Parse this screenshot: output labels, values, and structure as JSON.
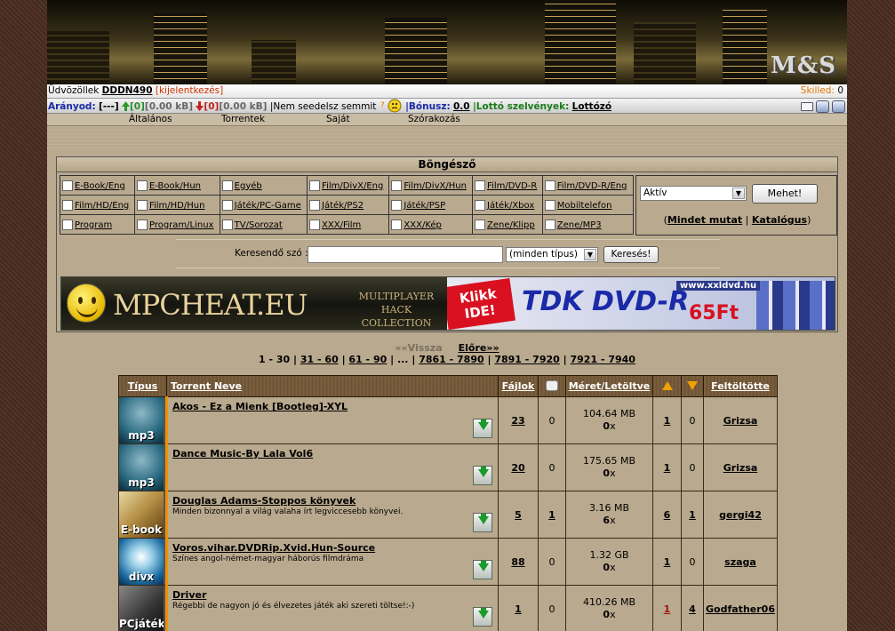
{
  "header": {
    "logo": "M&S"
  },
  "userbar": {
    "greeting": "Üdvözöllek",
    "username": "DDDN490",
    "logout": "[kijelentkezés]",
    "skilled_label": "Skilled:",
    "skilled_value": "0"
  },
  "statbar": {
    "ratio_label": "Arányod:",
    "ratio_value": "[---]",
    "up_count": "[0]",
    "up_size": "[0.00 kB]",
    "down_count": "[0]",
    "down_size": "[0.00 kB]",
    "seed_status": "|Nem seedelsz semmit",
    "bonus_label": "|Bónusz:",
    "bonus_value": "0.0",
    "lotto_label": "|Lottó szelvények:",
    "lotto_link": "Lottózó"
  },
  "menu": [
    "Általános",
    "Torrentek",
    "Saját",
    "Szórakozás"
  ],
  "browser": {
    "title": "Böngésző",
    "categories": [
      [
        "E-Book/Eng",
        "E-Book/Hun",
        "Egyéb",
        "Film/DivX/Eng",
        "Film/DivX/Hun",
        "Film/DVD-R",
        "Film/DVD-R/Eng"
      ],
      [
        "Film/HD/Eng",
        "Film/HD/Hun",
        "Játék/PC-Game",
        "Játék/PS2",
        "Játék/PSP",
        "Játék/Xbox",
        "Mobiltelefon"
      ],
      [
        "Program",
        "Program/Linux",
        "TV/Sorozat",
        "XXX/Film",
        "XXX/Kép",
        "Zene/Klipp",
        "Zene/MP3"
      ]
    ],
    "status_select": "Aktív",
    "go_button": "Mehet!",
    "link_open": "(",
    "show_all": "Mindet mutat",
    "sep": "|",
    "catalog": "Katalógus",
    "link_close": ")",
    "search_label": "Keresendő szó :",
    "search_value": "",
    "type_select": "(minden típus)",
    "search_button": "Keresés!"
  },
  "ads": {
    "ad1_title": "MPCHEAT.EU",
    "ad1_sub1": "MULTIPLAYER HACK",
    "ad1_sub2": "COLLECTION",
    "ad2_klikk1": "Klikk",
    "ad2_klikk2": "IDE!",
    "ad2_title": "TDK DVD-R",
    "ad2_site": "www.xxldvd.hu",
    "ad2_price": "65Ft"
  },
  "pager": {
    "prev": "««Vissza",
    "next": "Előre»»",
    "pages": [
      "1 - 30",
      "31 - 60",
      "61 - 90",
      "...",
      "7861 - 7890",
      "7891 - 7920",
      "7921 - 7940"
    ]
  },
  "table": {
    "headers": {
      "type": "Típus",
      "name": "Torrent Neve",
      "files": "Fájlok",
      "size": "Méret/Letöltve",
      "uploader": "Feltöltötte"
    },
    "rows": [
      {
        "cat": "mp3",
        "name": "Akos - Ez a Mienk [Bootleg]-XYL",
        "desc": "",
        "files": "23",
        "comments": "0",
        "size": "104.64 MB",
        "snatched": "0",
        "times": "x",
        "seeders": "1",
        "leechers": "0",
        "uploader": "Grizsa"
      },
      {
        "cat": "mp3",
        "name": "Dance Music-By Lala Vol6",
        "desc": "",
        "files": "20",
        "comments": "0",
        "size": "175.65 MB",
        "snatched": "0",
        "times": "x",
        "seeders": "1",
        "leechers": "0",
        "uploader": "Grizsa"
      },
      {
        "cat": "E-book",
        "name": "Douglas Adams-Stoppos könyvek",
        "desc": "Minden bizonnyal a világ valaha írt legviccesebb könyvei.",
        "files": "5",
        "comments": "1",
        "size": "3.16 MB",
        "snatched": "6",
        "times": "x",
        "seeders": "6",
        "leechers": "1",
        "uploader": "gergi42"
      },
      {
        "cat": "divx",
        "name": "Voros.vihar.DVDRip.Xvid.Hun-Source",
        "desc": "Színes angol-német-magyar háborús filmdráma",
        "files": "88",
        "comments": "0",
        "size": "1.32 GB",
        "snatched": "0",
        "times": "x",
        "seeders": "1",
        "leechers": "0",
        "uploader": "szaga"
      },
      {
        "cat": "PCjáték",
        "name": "Driver",
        "desc": "Régebbi de nagyon jó és élvezetes játék aki szereti töltse!:-)",
        "files": "1",
        "comments": "0",
        "size": "410.26 MB",
        "snatched": "0",
        "times": "x",
        "seeders": "1",
        "leechers": "4",
        "uploader": "Godfather06"
      }
    ]
  }
}
